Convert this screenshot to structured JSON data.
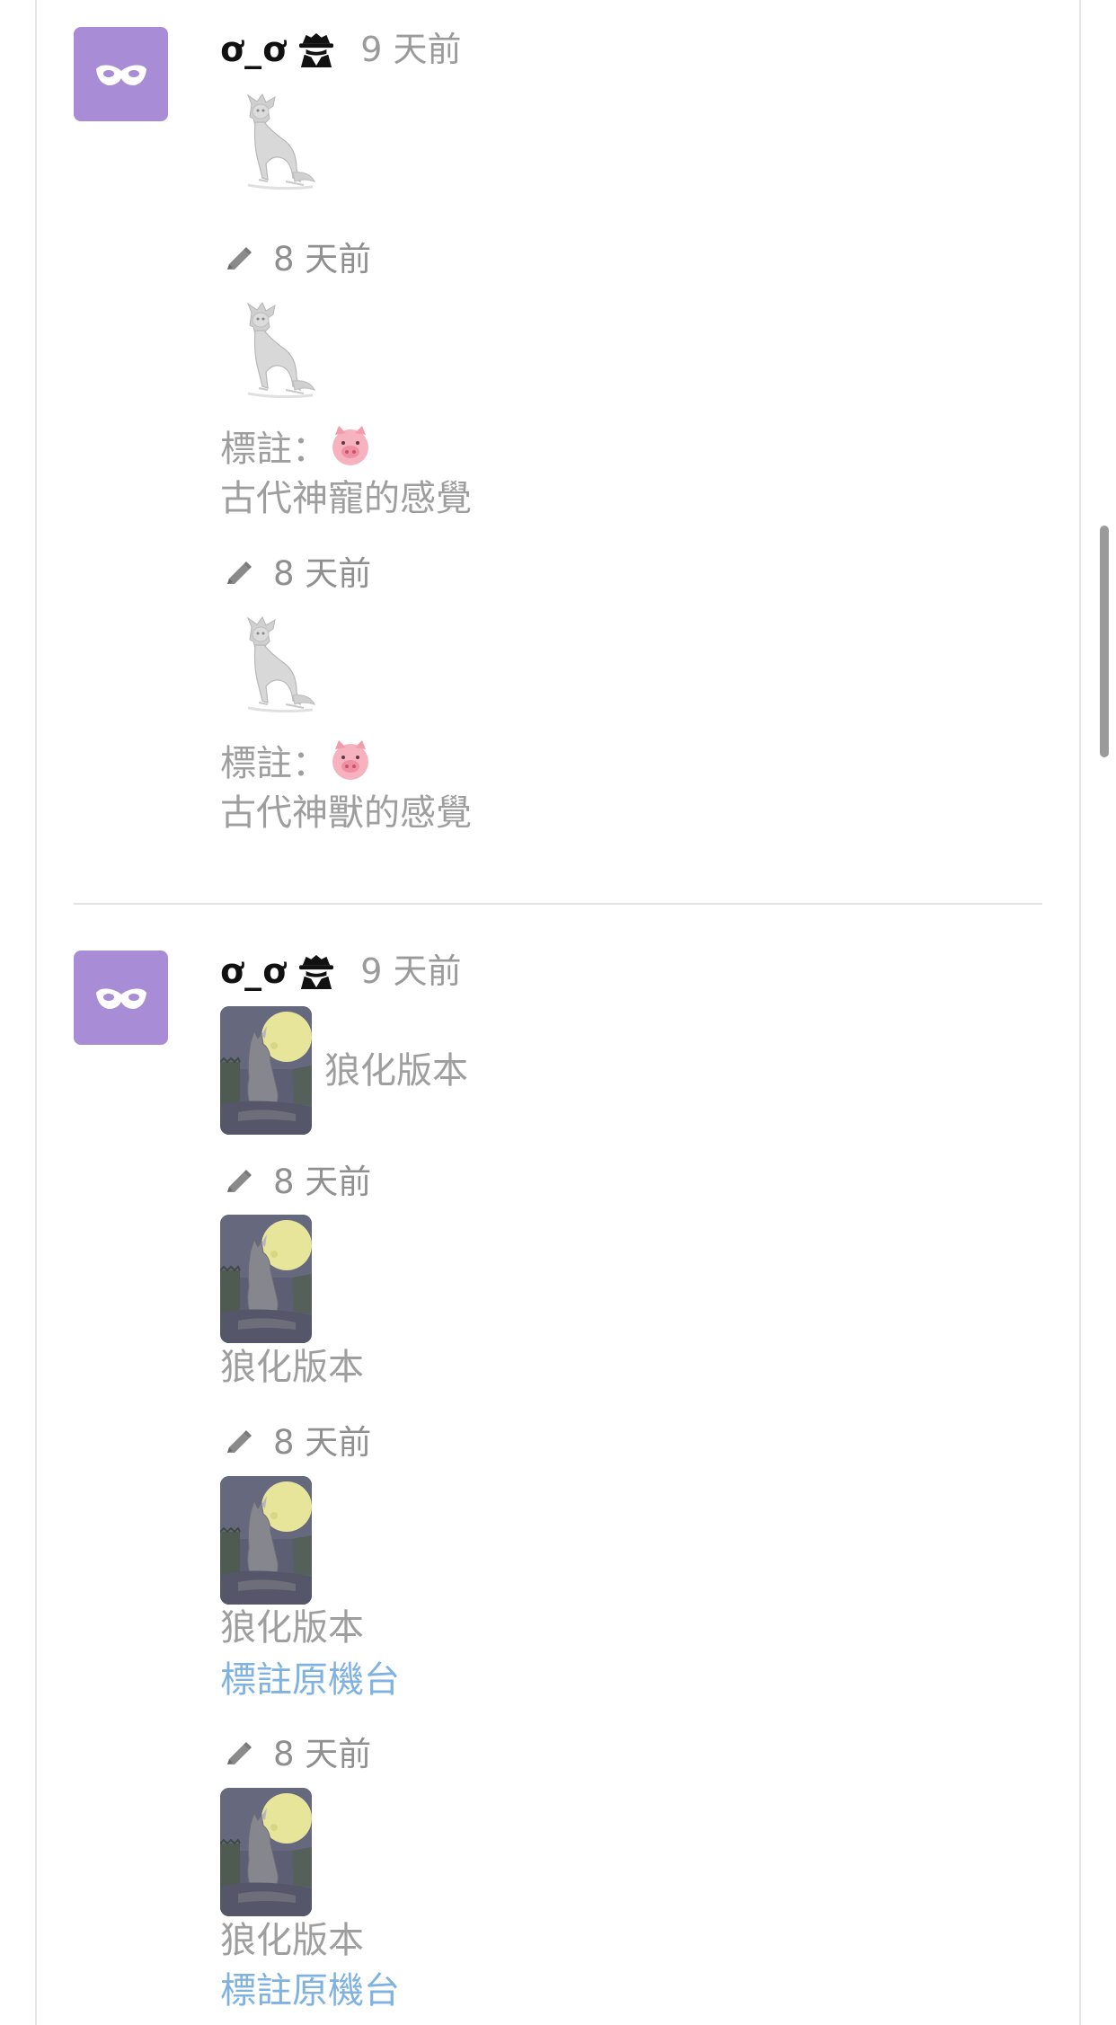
{
  "posts": [
    {
      "author": {
        "name": "ơ_ơ",
        "badge_icon": "spy-icon",
        "avatar_icon": "mask-icon",
        "avatar_color": "#a98cd6"
      },
      "time": "9 天前",
      "original": {
        "image": "wolf-sketch-image"
      },
      "edits": [
        {
          "time": "8 天前",
          "image": "wolf-sketch-image",
          "note_label": "標註：",
          "note_emoji": "pig-icon",
          "text": "古代神寵的感覺"
        },
        {
          "time": "8 天前",
          "image": "wolf-sketch-image",
          "note_label": "標註：",
          "note_emoji": "pig-icon",
          "text": "古代神獸的感覺"
        }
      ]
    },
    {
      "author": {
        "name": "ơ_ơ",
        "badge_icon": "spy-icon",
        "avatar_icon": "mask-icon",
        "avatar_color": "#a98cd6"
      },
      "time": "9 天前",
      "original": {
        "image": "werewolf-moon-image",
        "caption": "狼化版本"
      },
      "edits": [
        {
          "time": "8 天前",
          "image": "werewolf-moon-image",
          "text": "狼化版本"
        },
        {
          "time": "8 天前",
          "image": "werewolf-moon-image",
          "text": "狼化版本",
          "link": "標註原機台"
        },
        {
          "time": "8 天前",
          "image": "werewolf-moon-image",
          "text": "狼化版本",
          "link": "標註原機台"
        }
      ]
    }
  ],
  "colors": {
    "link": "#7fb2e0",
    "muted_text": "#9e9e9e",
    "separator": "#e3e3e3"
  }
}
